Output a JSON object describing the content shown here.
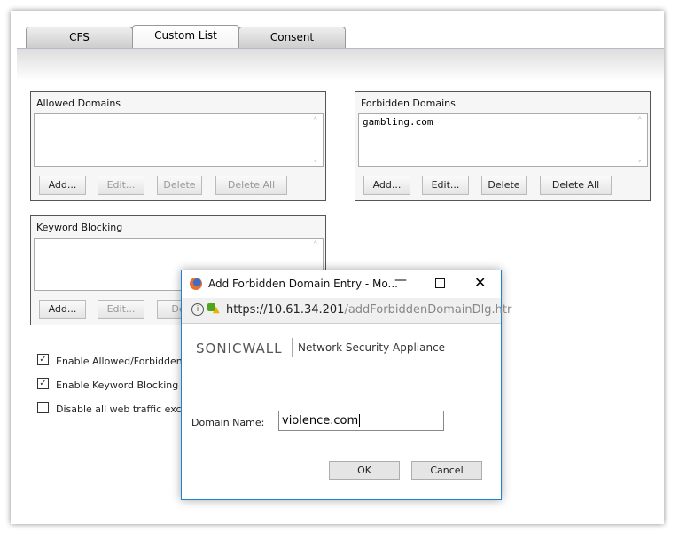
{
  "tabs": [
    {
      "label": "CFS"
    },
    {
      "label": "Custom List",
      "active": true
    },
    {
      "label": "Consent"
    }
  ],
  "allowed": {
    "title": "Allowed Domains",
    "items": [],
    "buttons": {
      "add": "Add...",
      "edit": "Edit...",
      "delete": "Delete",
      "delete_all": "Delete All"
    }
  },
  "forbidden": {
    "title": "Forbidden Domains",
    "items": [
      "gambling.com"
    ],
    "buttons": {
      "add": "Add...",
      "edit": "Edit...",
      "delete": "Delete",
      "delete_all": "Delete All"
    }
  },
  "keyword": {
    "title": "Keyword Blocking",
    "items": [],
    "buttons": {
      "add": "Add...",
      "edit": "Edit...",
      "delete": "Del"
    }
  },
  "options": [
    {
      "label": "Enable Allowed/Forbidden Do",
      "checked": true
    },
    {
      "label": "Enable Keyword Blocking",
      "checked": true
    },
    {
      "label": "Disable all web traffic except",
      "checked": false
    }
  ],
  "dialog": {
    "title": "Add Forbidden Domain Entry - Mo...",
    "url_host": "https://10.61.34.201",
    "url_path": "/addForbiddenDomainDlg.htr",
    "brand": "SONICWALL",
    "product": "Network Security Appliance",
    "field_label": "Domain Name:",
    "field_value": "violence.com",
    "ok": "OK",
    "cancel": "Cancel",
    "accent": "#1883d7"
  }
}
